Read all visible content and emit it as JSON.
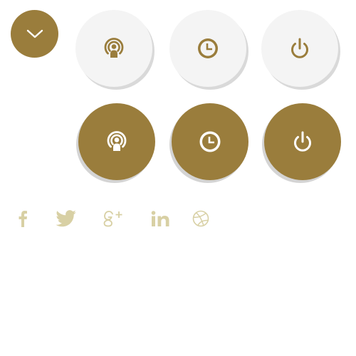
{
  "colors": {
    "accent": "#9a7d3c",
    "light_button_bg": "#f4f4f4",
    "social_icon": "#d8d0a4"
  },
  "dropdown": {
    "icon": "chevron-down-icon"
  },
  "buttons_light": [
    {
      "icon": "podcast-icon"
    },
    {
      "icon": "clock-icon"
    },
    {
      "icon": "power-icon"
    }
  ],
  "buttons_dark": [
    {
      "icon": "podcast-icon"
    },
    {
      "icon": "clock-icon"
    },
    {
      "icon": "power-icon"
    }
  ],
  "social_links": [
    {
      "icon": "facebook-icon"
    },
    {
      "icon": "twitter-icon"
    },
    {
      "icon": "google-plus-icon"
    },
    {
      "icon": "linkedin-icon"
    },
    {
      "icon": "dribbble-icon"
    }
  ]
}
